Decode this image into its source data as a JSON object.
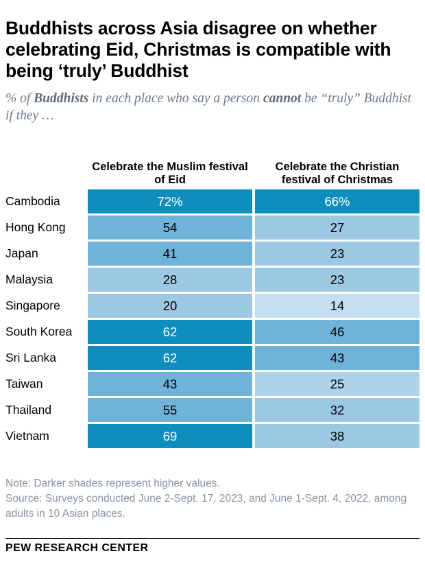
{
  "title": "Buddhists across Asia disagree on whether celebrating Eid, Christmas is compatible with being ‘truly’ Buddhist",
  "subtitle": {
    "part1": "% of ",
    "bold1": "Buddhists",
    "part2": " in each place who say a person ",
    "bold2": "cannot",
    "part3": " be “truly” Buddhist if they …"
  },
  "notes": {
    "note": "Note: Darker shades represent higher values.",
    "source": "Source: Surveys conducted June 2-Sept. 17, 2023, and June 1-Sept. 4, 2022, among adults in 10 Asian places."
  },
  "brand": "PEW RESEARCH CENTER",
  "colors": {
    "shade_darkest": "#0d8ebc",
    "shade_dark": "#4da7d0",
    "shade_mid": "#6fb3d9",
    "shade_light": "#9dc8e4",
    "shade_lighter": "#aed2e9",
    "shade_lightest": "#c6dff0",
    "text_dark": "#000000",
    "text_light": "#ffffff",
    "note_gray": "#8a939c",
    "subtitle_gray": "#6e7a85"
  },
  "chart_data": {
    "type": "heatmap",
    "title": "Buddhists across Asia disagree on whether celebrating Eid, Christmas is compatible with being ‘truly’ Buddhist",
    "subtitle": "% of Buddhists in each place who say a person cannot be “truly” Buddhist if they …",
    "xlabel": "",
    "ylabel": "",
    "grid": false,
    "legend": "none",
    "note": "Darker shades represent higher values.",
    "categories": [
      "Cambodia",
      "Hong Kong",
      "Japan",
      "Malaysia",
      "Singapore",
      "South Korea",
      "Sri Lanka",
      "Taiwan",
      "Thailand",
      "Vietnam"
    ],
    "columns": [
      "Celebrate the Muslim festival of Eid",
      "Celebrate the Christian festival of Christmas"
    ],
    "series": [
      {
        "name": "Celebrate the Muslim festival of Eid",
        "values": [
          72,
          54,
          41,
          28,
          20,
          62,
          62,
          43,
          55,
          69
        ]
      },
      {
        "name": "Celebrate the Christian festival of Christmas",
        "values": [
          66,
          27,
          23,
          23,
          14,
          46,
          43,
          25,
          32,
          38
        ]
      }
    ],
    "rows": [
      {
        "label": "Cambodia",
        "eid": {
          "display": "72%",
          "value": 72,
          "fill": "#0d8ebc",
          "text": "#ffffff"
        },
        "christmas": {
          "display": "66%",
          "value": 66,
          "fill": "#0d8ebc",
          "text": "#ffffff"
        }
      },
      {
        "label": "Hong Kong",
        "eid": {
          "display": "54",
          "value": 54,
          "fill": "#6fb3d9",
          "text": "#000000"
        },
        "christmas": {
          "display": "27",
          "value": 27,
          "fill": "#9dc8e4",
          "text": "#000000"
        }
      },
      {
        "label": "Japan",
        "eid": {
          "display": "41",
          "value": 41,
          "fill": "#6fb3d9",
          "text": "#000000"
        },
        "christmas": {
          "display": "23",
          "value": 23,
          "fill": "#9dc8e4",
          "text": "#000000"
        }
      },
      {
        "label": "Malaysia",
        "eid": {
          "display": "28",
          "value": 28,
          "fill": "#9dc8e4",
          "text": "#000000"
        },
        "christmas": {
          "display": "23",
          "value": 23,
          "fill": "#9dc8e4",
          "text": "#000000"
        }
      },
      {
        "label": "Singapore",
        "eid": {
          "display": "20",
          "value": 20,
          "fill": "#9dc8e4",
          "text": "#000000"
        },
        "christmas": {
          "display": "14",
          "value": 14,
          "fill": "#c6dff0",
          "text": "#000000"
        }
      },
      {
        "label": "South Korea",
        "eid": {
          "display": "62",
          "value": 62,
          "fill": "#0d8ebc",
          "text": "#ffffff"
        },
        "christmas": {
          "display": "46",
          "value": 46,
          "fill": "#6fb3d9",
          "text": "#000000"
        }
      },
      {
        "label": "Sri Lanka",
        "eid": {
          "display": "62",
          "value": 62,
          "fill": "#0d8ebc",
          "text": "#ffffff"
        },
        "christmas": {
          "display": "43",
          "value": 43,
          "fill": "#6fb3d9",
          "text": "#000000"
        }
      },
      {
        "label": "Taiwan",
        "eid": {
          "display": "43",
          "value": 43,
          "fill": "#6fb3d9",
          "text": "#000000"
        },
        "christmas": {
          "display": "25",
          "value": 25,
          "fill": "#aed2e9",
          "text": "#000000"
        }
      },
      {
        "label": "Thailand",
        "eid": {
          "display": "55",
          "value": 55,
          "fill": "#6fb3d9",
          "text": "#000000"
        },
        "christmas": {
          "display": "32",
          "value": 32,
          "fill": "#9dc8e4",
          "text": "#000000"
        }
      },
      {
        "label": "Vietnam",
        "eid": {
          "display": "69",
          "value": 69,
          "fill": "#0d8ebc",
          "text": "#ffffff"
        },
        "christmas": {
          "display": "38",
          "value": 38,
          "fill": "#9dc8e4",
          "text": "#000000"
        }
      }
    ]
  }
}
